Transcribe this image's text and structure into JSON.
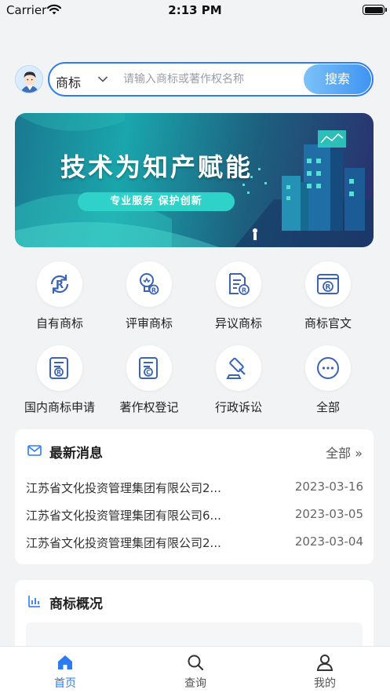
{
  "status_bar": {
    "carrier": "Carrier",
    "time": "2:13 PM"
  },
  "search": {
    "type_label": "商标",
    "placeholder": "请输入商标或著作权名称",
    "button_label": "搜索"
  },
  "banner": {
    "title": "技术为知产赋能",
    "slogan": "专业服务   保护创新"
  },
  "services": [
    {
      "label": "自有商标",
      "icon": "trademark-r-cycle-icon"
    },
    {
      "label": "评审商标",
      "icon": "review-bulb-icon"
    },
    {
      "label": "异议商标",
      "icon": "objection-document-icon"
    },
    {
      "label": "商标官文",
      "icon": "official-document-icon"
    },
    {
      "label": "国内商标申请",
      "icon": "trademark-application-icon"
    },
    {
      "label": "著作权登记",
      "icon": "copyright-registration-icon"
    },
    {
      "label": "行政诉讼",
      "icon": "gavel-icon"
    },
    {
      "label": "全部",
      "icon": "more-dots-icon"
    }
  ],
  "news": {
    "title": "最新消息",
    "all_label": "全部 »",
    "items": [
      {
        "text": "江苏省文化投资管理集团有限公司2...",
        "date": "2023-03-16"
      },
      {
        "text": "江苏省文化投资管理集团有限公司6...",
        "date": "2023-03-05"
      },
      {
        "text": "江苏省文化投资管理集团有限公司2...",
        "date": "2023-03-04"
      }
    ]
  },
  "overview": {
    "title": "商标概况"
  },
  "tabs": [
    {
      "label": "首页",
      "icon": "home-icon",
      "active": true
    },
    {
      "label": "查询",
      "icon": "search-icon",
      "active": false
    },
    {
      "label": "我的",
      "icon": "user-icon",
      "active": false
    }
  ],
  "colors": {
    "accent": "#2d7bf0",
    "page_bg": "#f2f3f5",
    "icon_blue": "#3b64b8"
  }
}
